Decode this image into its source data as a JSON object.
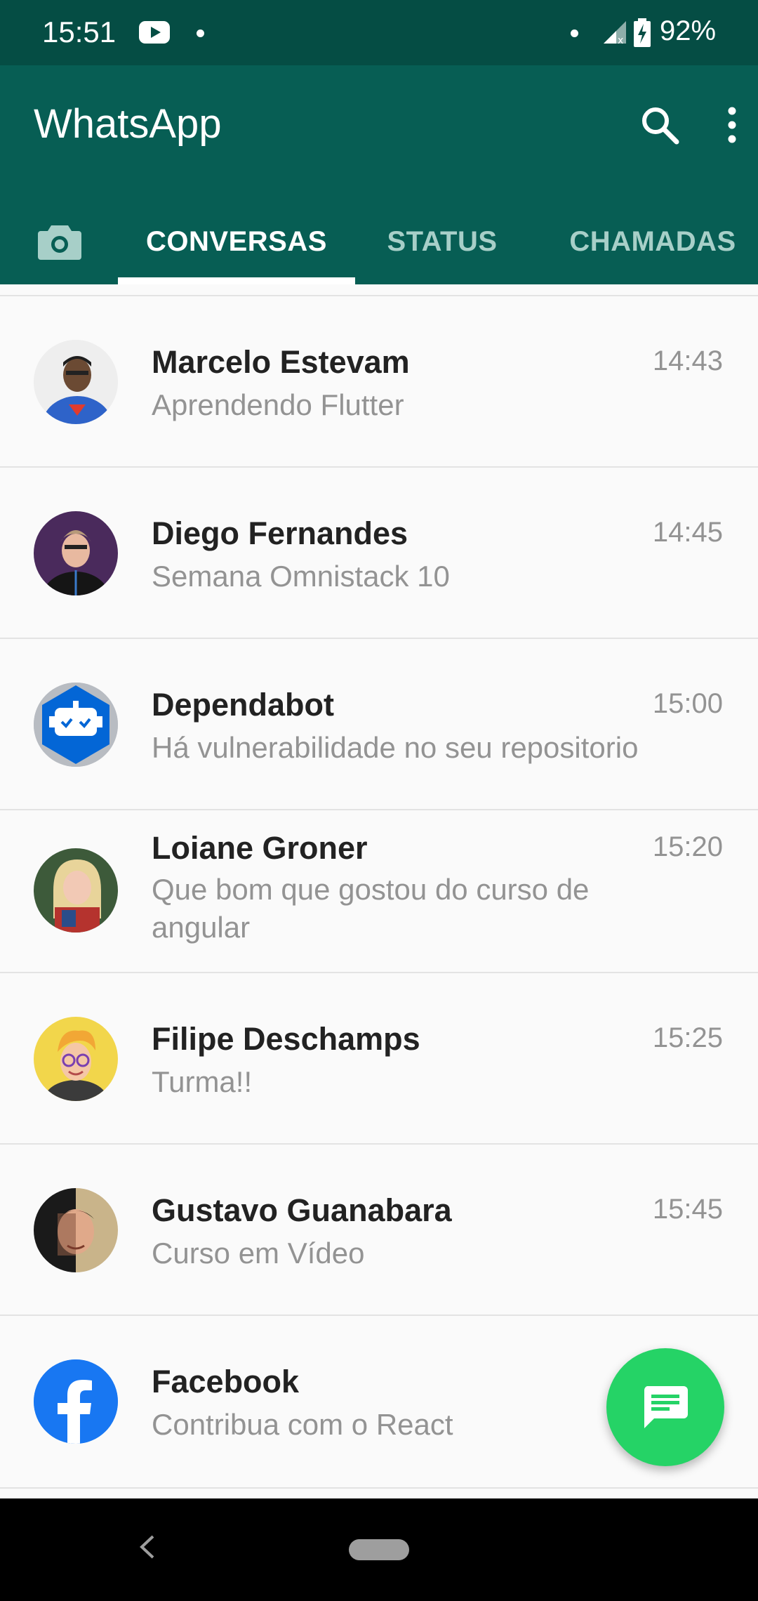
{
  "status_bar": {
    "time": "15:51",
    "battery": "92%",
    "icons": [
      "youtube-icon",
      "dot-icon",
      "signal-icon",
      "battery-charging-icon"
    ]
  },
  "app_bar": {
    "title": "WhatsApp",
    "icons": [
      "search-icon",
      "more-vert-icon"
    ]
  },
  "tabs": [
    {
      "label": "CONVERSAS",
      "selected": true
    },
    {
      "label": "STATUS",
      "selected": false
    },
    {
      "label": "CHAMADAS",
      "selected": false
    }
  ],
  "chats": [
    {
      "name": "Marcelo Estevam",
      "message": "Aprendendo Flutter",
      "time": "14:43"
    },
    {
      "name": "Diego Fernandes",
      "message": "Semana Omnistack 10",
      "time": "14:45"
    },
    {
      "name": "Dependabot",
      "message": "Há vulnerabilidade no seu repositorio",
      "time": "15:00"
    },
    {
      "name": "Loiane Groner",
      "message": "Que bom que gostou do curso de angular",
      "time": "15:20"
    },
    {
      "name": "Filipe Deschamps",
      "message": "Turma!!",
      "time": "15:25"
    },
    {
      "name": "Gustavo Guanabara",
      "message": "Curso em Vídeo",
      "time": "15:45"
    },
    {
      "name": "Facebook",
      "message": "Contribua com o React",
      "time": ""
    }
  ],
  "colors": {
    "header": "#075e54",
    "status_bar": "#054d44",
    "fab": "#25d366",
    "inactive_tab": "#a7cfc8",
    "secondary_text": "#939393"
  }
}
